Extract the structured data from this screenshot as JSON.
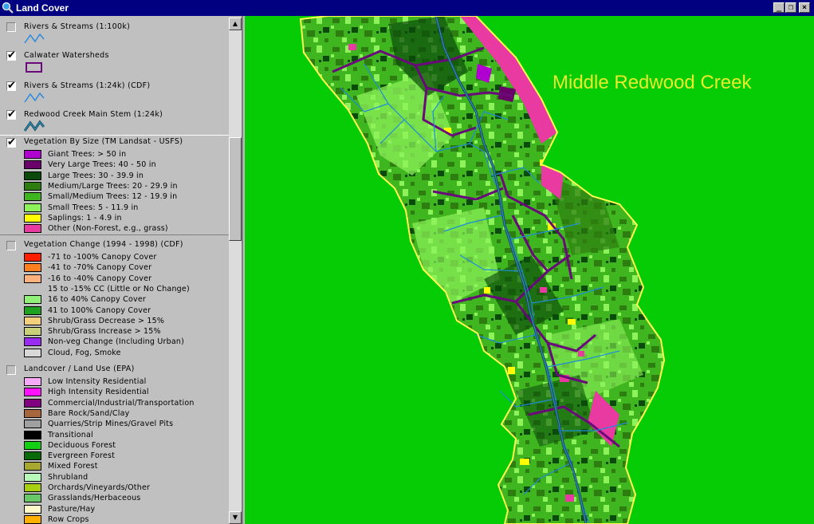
{
  "window": {
    "title": "Land Cover",
    "buttons": {
      "minimize": "_",
      "restore": "❐",
      "close": "×"
    }
  },
  "legend": {
    "themes": [
      {
        "name": "Rivers & Streams (1:100k)",
        "checked": false,
        "symbol": "line-blue"
      },
      {
        "name": "Calwater Watersheds",
        "checked": true,
        "symbol": "polygon-purple"
      },
      {
        "name": "Rivers & Streams (1:24k) (CDF)",
        "checked": true,
        "symbol": "line-blue"
      },
      {
        "name": "Redwood Creek Main Stem (1:24k)",
        "checked": true,
        "symbol": "line-dark"
      },
      {
        "name": "Vegetation By Size (TM Landsat - USFS)",
        "checked": true,
        "classes": [
          {
            "label": "Giant Trees: > 50 in",
            "color": "#b000d0"
          },
          {
            "label": "Very Large Trees: 40 - 50 in",
            "color": "#6a006a"
          },
          {
            "label": "Large Trees: 30 - 39.9 in",
            "color": "#0b4a0b"
          },
          {
            "label": "Medium/Large Trees: 20 - 29.9 in",
            "color": "#2e7d10"
          },
          {
            "label": "Small/Medium Trees: 12 - 19.9 in",
            "color": "#3fb51f"
          },
          {
            "label": "Small Trees: 5 - 11.9 in",
            "color": "#8ef25a"
          },
          {
            "label": "Saplings: 1 - 4.9 in",
            "color": "#ffff00"
          },
          {
            "label": "Other (Non-Forest, e.g., grass)",
            "color": "#e83aa0"
          }
        ]
      },
      {
        "name": "Vegetation Change (1994 - 1998) (CDF)",
        "checked": false,
        "classes": [
          {
            "label": "-71 to -100% Canopy Cover",
            "color": "#ff1e00"
          },
          {
            "label": "-41 to -70% Canopy Cover",
            "color": "#ff7e20"
          },
          {
            "label": "-16 to -40% Canopy Cover",
            "color": "#ffb07c"
          },
          {
            "label": "15 to -15% CC (Little or No Change)",
            "color": ""
          },
          {
            "label": "16 to 40% Canopy Cover",
            "color": "#90f07a"
          },
          {
            "label": "41 to 100% Canopy Cover",
            "color": "#1fa21f"
          },
          {
            "label": "Shrub/Grass Decrease > 15%",
            "color": "#f4d07c"
          },
          {
            "label": "Shrub/Grass Increase > 15%",
            "color": "#c8d078"
          },
          {
            "label": "Non-veg Change (Including Urban)",
            "color": "#9a2cf2"
          },
          {
            "label": "Cloud, Fog, Smoke",
            "color": "#d8d8d8"
          }
        ]
      },
      {
        "name": "Landcover / Land Use (EPA)",
        "checked": false,
        "classes": [
          {
            "label": "Low Intensity Residential",
            "color": "#f8a8f8"
          },
          {
            "label": "High Intensity Residential",
            "color": "#ff10ff"
          },
          {
            "label": "Commercial/Industrial/Transportation",
            "color": "#800080"
          },
          {
            "label": "Bare Rock/Sand/Clay",
            "color": "#a8663c"
          },
          {
            "label": "Quarries/Strip Mines/Gravel Pits",
            "color": "#a0a0a0"
          },
          {
            "label": "Transitional",
            "color": "#000000"
          },
          {
            "label": "Deciduous Forest",
            "color": "#14d014"
          },
          {
            "label": "Evergreen Forest",
            "color": "#0a6a0a"
          },
          {
            "label": "Mixed Forest",
            "color": "#a8a830"
          },
          {
            "label": "Shrubland",
            "color": "#b8f8b8"
          },
          {
            "label": "Orchards/Vineyards/Other",
            "color": "#a8d010"
          },
          {
            "label": "Grasslands/Herbaceous",
            "color": "#68c868"
          },
          {
            "label": "Pasture/Hay",
            "color": "#fff8c8"
          },
          {
            "label": "Row Crops",
            "color": "#ffb000"
          }
        ]
      }
    ]
  },
  "map": {
    "label": "Middle Redwood Creek",
    "colors": {
      "background": "#05cc05",
      "boundary": "#ffff50",
      "watershed": "#6a0a7a",
      "stream": "#1e8cd8",
      "other": "#e83aa0"
    }
  }
}
